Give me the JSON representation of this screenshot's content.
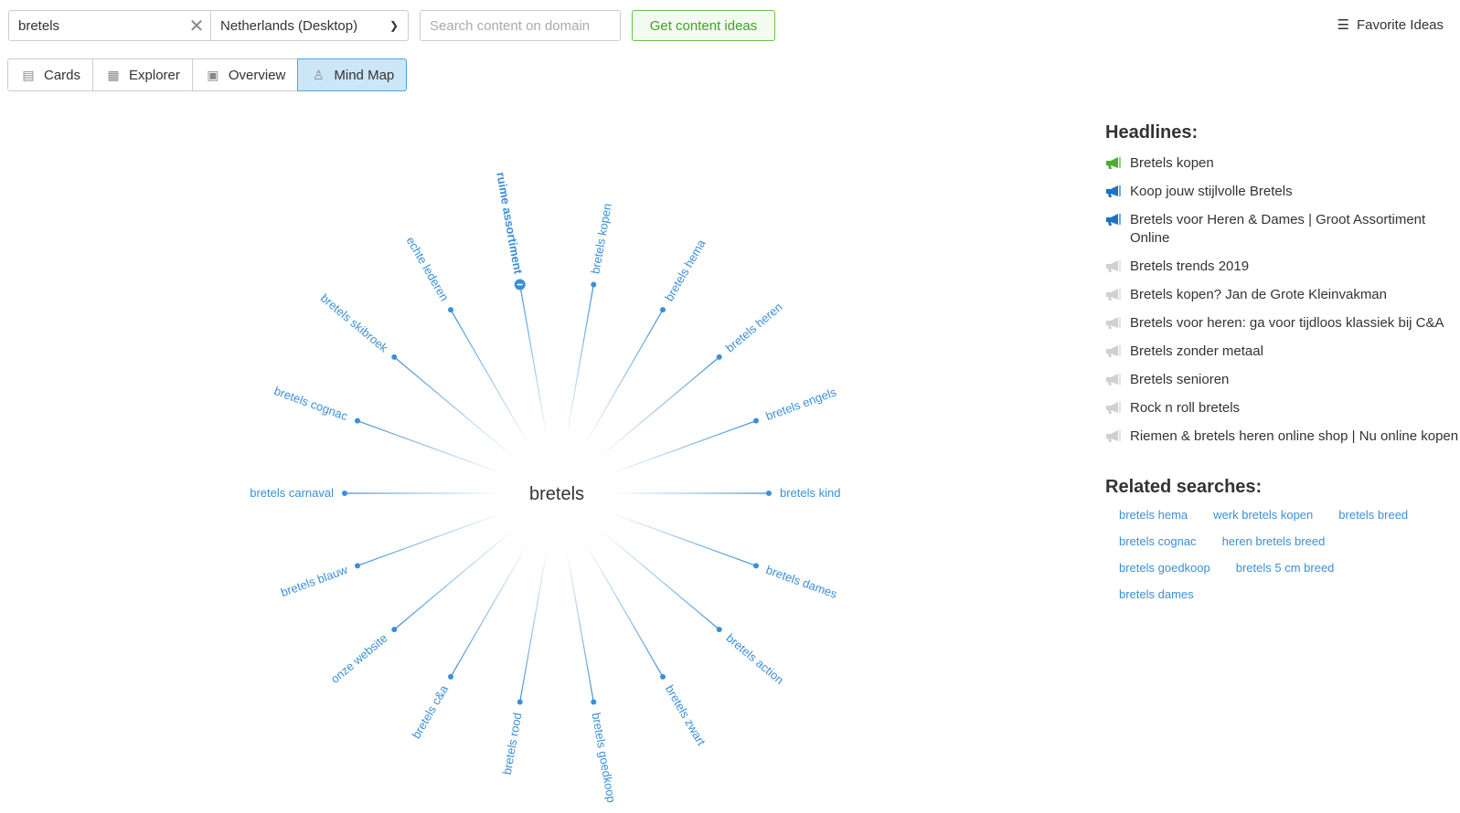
{
  "search": {
    "keyword": "bretels",
    "country": "Netherlands (Desktop)",
    "domain_placeholder": "Search content on domain",
    "submit_label": "Get content ideas"
  },
  "favorites_label": "Favorite Ideas",
  "tabs": [
    {
      "label": "Cards",
      "icon": "cards-icon"
    },
    {
      "label": "Explorer",
      "icon": "table-icon"
    },
    {
      "label": "Overview",
      "icon": "overview-icon"
    },
    {
      "label": "Mind Map",
      "icon": "mind-map-icon",
      "active": true
    }
  ],
  "mindmap": {
    "center": "bretels",
    "selected": "ruime assortiment",
    "color": "#3b8fd8",
    "nodes": [
      "bretels kind",
      "bretels dames",
      "bretels action",
      "bretels zwart",
      "bretels goedkoop",
      "bretels rood",
      "bretels c&a",
      "onze website",
      "bretels blauw",
      "bretels carnaval",
      "bretels cognac",
      "bretels skibroek",
      "echte lederen",
      "ruime assortiment",
      "bretels kopen",
      "bretels hema",
      "bretels heren",
      "bretels engels"
    ]
  },
  "headlines_title": "Headlines:",
  "headlines": [
    {
      "text": "Bretels kopen",
      "status": "green"
    },
    {
      "text": "Koop jouw stijlvolle Bretels",
      "status": "blue"
    },
    {
      "text": "Bretels voor Heren & Dames | Groot Assortiment Online",
      "status": "blue"
    },
    {
      "text": "Bretels trends 2019",
      "status": "gray"
    },
    {
      "text": "Bretels kopen? Jan de Grote Kleinvakman",
      "status": "gray"
    },
    {
      "text": "Bretels voor heren: ga voor tijdloos klassiek bij C&A",
      "status": "gray"
    },
    {
      "text": "Bretels zonder metaal",
      "status": "gray"
    },
    {
      "text": "Bretels senioren",
      "status": "gray"
    },
    {
      "text": "Rock n roll bretels",
      "status": "gray"
    },
    {
      "text": "Riemen & bretels heren online shop | Nu online kopen",
      "status": "gray"
    }
  ],
  "status_colors": {
    "green": "#4caf2c",
    "blue": "#1a73c7",
    "gray": "#d0d0d0"
  },
  "related_title": "Related searches:",
  "related": [
    "bretels hema",
    "werk bretels kopen",
    "bretels breed",
    "bretels cognac",
    "heren bretels breed",
    "bretels goedkoop",
    "bretels 5 cm breed",
    "bretels dames"
  ]
}
